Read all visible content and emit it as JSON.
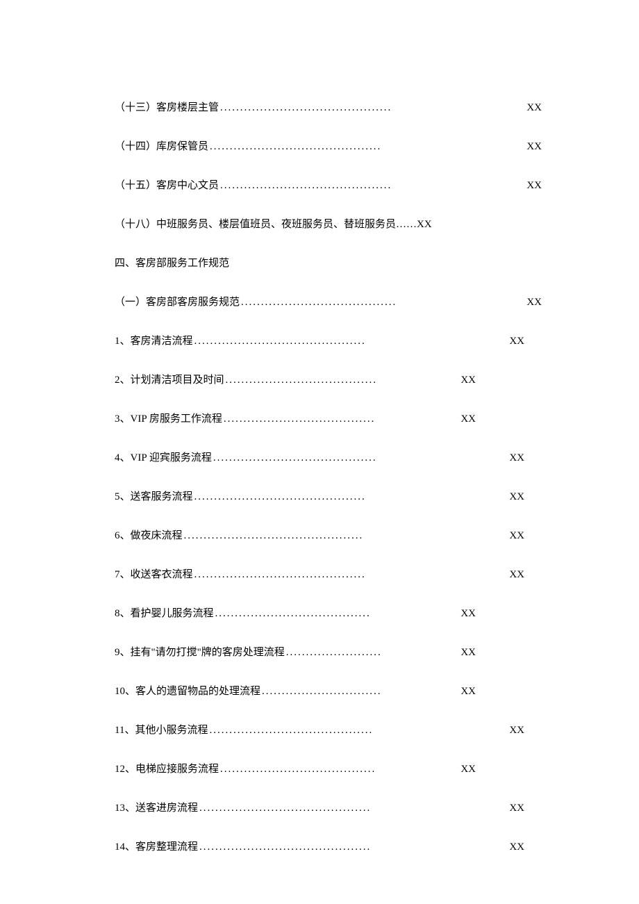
{
  "toc": {
    "items": [
      {
        "label": "（十三）客房楼层主管",
        "page": "XX",
        "dots": "long"
      },
      {
        "label": "（十四）库房保管员",
        "page": "XX",
        "dots": "long"
      },
      {
        "label": "（十五）客房中心文员",
        "page": "XX",
        "dots": "long"
      },
      {
        "label": "（十八）中班服务员、楼层值班员、夜班服务员、替班服务员……",
        "page": "XX",
        "dots": "none"
      }
    ],
    "section_heading": "四、客房部服务工作规范",
    "subitems": [
      {
        "label": "（一）客房部客房服务规范 ",
        "page": "XX",
        "dots": "long2"
      },
      {
        "label": "1、客房清洁流程 ",
        "page": "XX",
        "dots": "med"
      },
      {
        "label": "2、计划清洁项目及时间",
        "page": "XX",
        "dots": "short"
      },
      {
        "label": "3、VIP 房服务工作流程",
        "page": "XX",
        "dots": "short"
      },
      {
        "label": "4、VIP 迎宾服务流程",
        "page": "XX",
        "dots": "med2"
      },
      {
        "label": "5、送客服务流程 ",
        "page": "XX",
        "dots": "med"
      },
      {
        "label": "6、做夜床流程 ",
        "page": "XX",
        "dots": "med3"
      },
      {
        "label": "7、收送客衣流程 ",
        "page": "XX",
        "dots": "med"
      },
      {
        "label": "8、看护婴儿服务流程 ",
        "page": "XX",
        "dots": "short2"
      },
      {
        "label": "9、挂有\"请勿打搅\"牌的客房处理流程 ",
        "page": "XX",
        "dots": "tiny"
      },
      {
        "label": "10、客人的遗留物品的处理流程 ",
        "page": "XX",
        "dots": "short3"
      },
      {
        "label": "11、其他小服务流程 ",
        "page": "XX",
        "dots": "med2"
      },
      {
        "label": "12、电梯应接服务流程 ",
        "page": "XX",
        "dots": "short2"
      },
      {
        "label": "13、送客进房流程 ",
        "page": "XX",
        "dots": "med"
      },
      {
        "label": "14、客房整理流程 ",
        "page": "XX",
        "dots": "med"
      }
    ]
  },
  "dotstrings": {
    "long": "...........................................",
    "long2": ".......................................",
    "med": "...........................................",
    "med2": ".........................................",
    "med3": ".............................................",
    "short": "......................................",
    "short2": ".......................................",
    "short3": "..............................",
    "tiny": "........................",
    "none": ""
  }
}
